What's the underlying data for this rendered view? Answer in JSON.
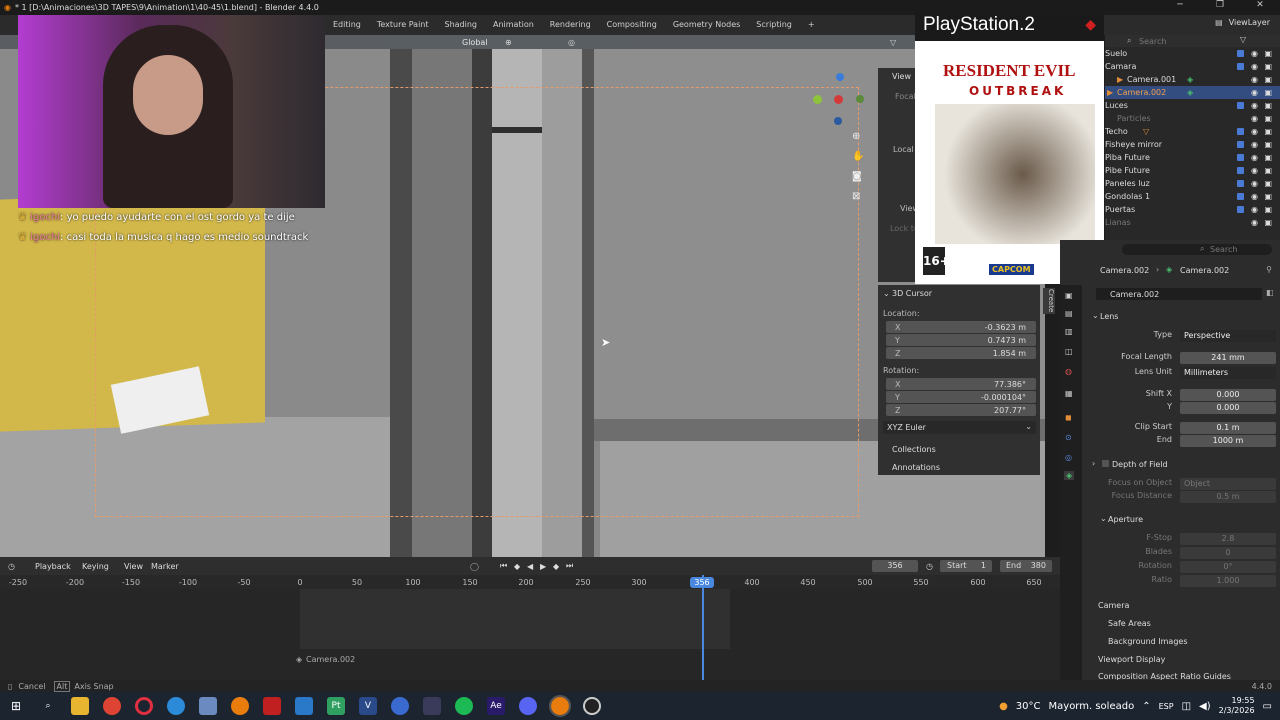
{
  "titlebar": {
    "title": "* 1 [D:\\Animaciones\\3D TAPES\\9\\Animation\\1\\40-45\\1.blend] - Blender 4.4.0"
  },
  "menubar": {
    "workspaces": [
      "Editing",
      "Texture Paint",
      "Shading",
      "Animation",
      "Rendering",
      "Compositing",
      "Geometry Nodes",
      "Scripting"
    ],
    "add_tab": "+",
    "view_layer": "ViewLayer"
  },
  "viewport": {
    "orientation": "Global",
    "npanel_view": "View",
    "npanel_focal": "Focal",
    "npanel_local": "Local",
    "npanel_view2": "View",
    "npanel_lock": "Lock to"
  },
  "cursor_panel": {
    "title": "3D Cursor",
    "location_label": "Location:",
    "loc": [
      {
        "axis": "X",
        "value": "-0.3623 m"
      },
      {
        "axis": "Y",
        "value": "0.7473 m"
      },
      {
        "axis": "Z",
        "value": "1.854 m"
      }
    ],
    "rotation_label": "Rotation:",
    "rot": [
      {
        "axis": "X",
        "value": "77.386°"
      },
      {
        "axis": "Y",
        "value": "-0.000104°"
      },
      {
        "axis": "Z",
        "value": "207.77°"
      }
    ],
    "rot_mode": "XYZ Euler",
    "collections": "Collections",
    "annotations": "Annotations",
    "side_tab": "Create"
  },
  "outliner": {
    "search_placeholder": "Search",
    "items": [
      "Suelo",
      "Camara",
      "Camera.001",
      "Camera.002",
      "Luces",
      "Particles",
      "Techo",
      "Fisheye mirror",
      "Piba Future",
      "Pibe Future",
      "Paneles luz",
      "Gondolas 1",
      "Puertas",
      "Lianas"
    ]
  },
  "properties": {
    "search_placeholder": "Search",
    "breadcrumb_a": "Camera.002",
    "breadcrumb_b": "Camera.002",
    "data_name": "Camera.002",
    "lens_header": "Lens",
    "type_label": "Type",
    "type_value": "Perspective",
    "focal_label": "Focal Length",
    "focal_value": "241 mm",
    "unit_label": "Lens Unit",
    "unit_value": "Millimeters",
    "shiftx_label": "Shift X",
    "shiftx_value": "0.000",
    "shifty_label": "Y",
    "shifty_value": "0.000",
    "clipstart_label": "Clip Start",
    "clipstart_value": "0.1 m",
    "clipend_label": "End",
    "clipend_value": "1000 m",
    "dof_header": "Depth of Field",
    "focus_obj_label": "Focus on Object",
    "focus_obj_placeholder": "Object",
    "focus_dist_label": "Focus Distance",
    "focus_dist_value": "0.5 m",
    "aperture_header": "Aperture",
    "fstop_label": "F-Stop",
    "fstop_value": "2.8",
    "blades_label": "Blades",
    "blades_value": "0",
    "rotation_label": "Rotation",
    "rotation_value": "0°",
    "ratio_label": "Ratio",
    "ratio_value": "1.000",
    "panels": [
      "Camera",
      "Safe Areas",
      "Background Images",
      "Viewport Display",
      "Composition Aspect Ratio Guides"
    ],
    "version": "4.4.0"
  },
  "timeline": {
    "menus": [
      "Playback",
      "Keying",
      "View",
      "Marker"
    ],
    "current_frame": "356",
    "start_label": "Start",
    "start_value": "1",
    "end_label": "End",
    "end_value": "380",
    "ticks": [
      "-250",
      "-200",
      "-150",
      "-100",
      "-50",
      "0",
      "50",
      "100",
      "150",
      "200",
      "250",
      "300",
      "350",
      "400",
      "450",
      "500",
      "550",
      "600",
      "650"
    ],
    "playhead": "356",
    "marker": "Camera.002"
  },
  "statusbar": {
    "cancel": "Cancel",
    "alt": "Alt",
    "axis_snap": "Axis Snap"
  },
  "stream_chat": [
    {
      "name": "igochi",
      "message": "yo puedo ayudarte con el ost gordo ya te dije"
    },
    {
      "name": "igochi",
      "message": "casi toda la musica q hago es medio soundtrack"
    }
  ],
  "overlay_cover": {
    "platform": "PlayStation.2",
    "title_line1": "RESIDENT EVIL",
    "title_line2": "OUTBREAK",
    "rating": "16+",
    "publisher": "CAPCOM"
  },
  "taskbar": {
    "weather_temp": "30°C",
    "weather_text": "Mayorm. soleado",
    "lang": "ESP",
    "time": "19:55",
    "date": "2/3/2026"
  }
}
